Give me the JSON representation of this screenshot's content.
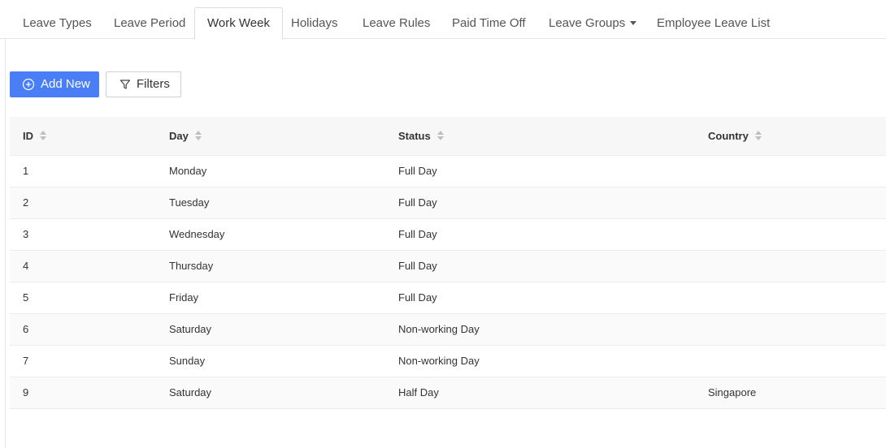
{
  "tabs": [
    {
      "label": "Leave Types",
      "active": false
    },
    {
      "label": "Leave Period",
      "active": false
    },
    {
      "label": "Work Week",
      "active": true
    },
    {
      "label": "Holidays",
      "active": false
    },
    {
      "label": "Leave Rules",
      "active": false
    },
    {
      "label": "Paid Time Off",
      "active": false
    },
    {
      "label": "Leave Groups",
      "active": false,
      "dropdown": true
    },
    {
      "label": "Employee Leave List",
      "active": false
    }
  ],
  "toolbar": {
    "add_label": "Add New",
    "add_icon": "plus-circle-icon",
    "filter_label": "Filters",
    "filter_icon": "filter-icon"
  },
  "table": {
    "columns": [
      "ID",
      "Day",
      "Status",
      "Country"
    ],
    "sort_icon": "sort-icon",
    "rows": [
      [
        "1",
        "Monday",
        "Full Day",
        ""
      ],
      [
        "2",
        "Tuesday",
        "Full Day",
        ""
      ],
      [
        "3",
        "Wednesday",
        "Full Day",
        ""
      ],
      [
        "4",
        "Thursday",
        "Full Day",
        ""
      ],
      [
        "5",
        "Friday",
        "Full Day",
        ""
      ],
      [
        "6",
        "Saturday",
        "Non-working Day",
        ""
      ],
      [
        "7",
        "Sunday",
        "Non-working Day",
        ""
      ],
      [
        "9",
        "Saturday",
        "Half Day",
        "Singapore"
      ]
    ]
  },
  "colors": {
    "primary": "#4a7ef6",
    "header_bg": "#f7f7f7",
    "row_alt_bg": "#fafafa",
    "border": "#ececec"
  }
}
